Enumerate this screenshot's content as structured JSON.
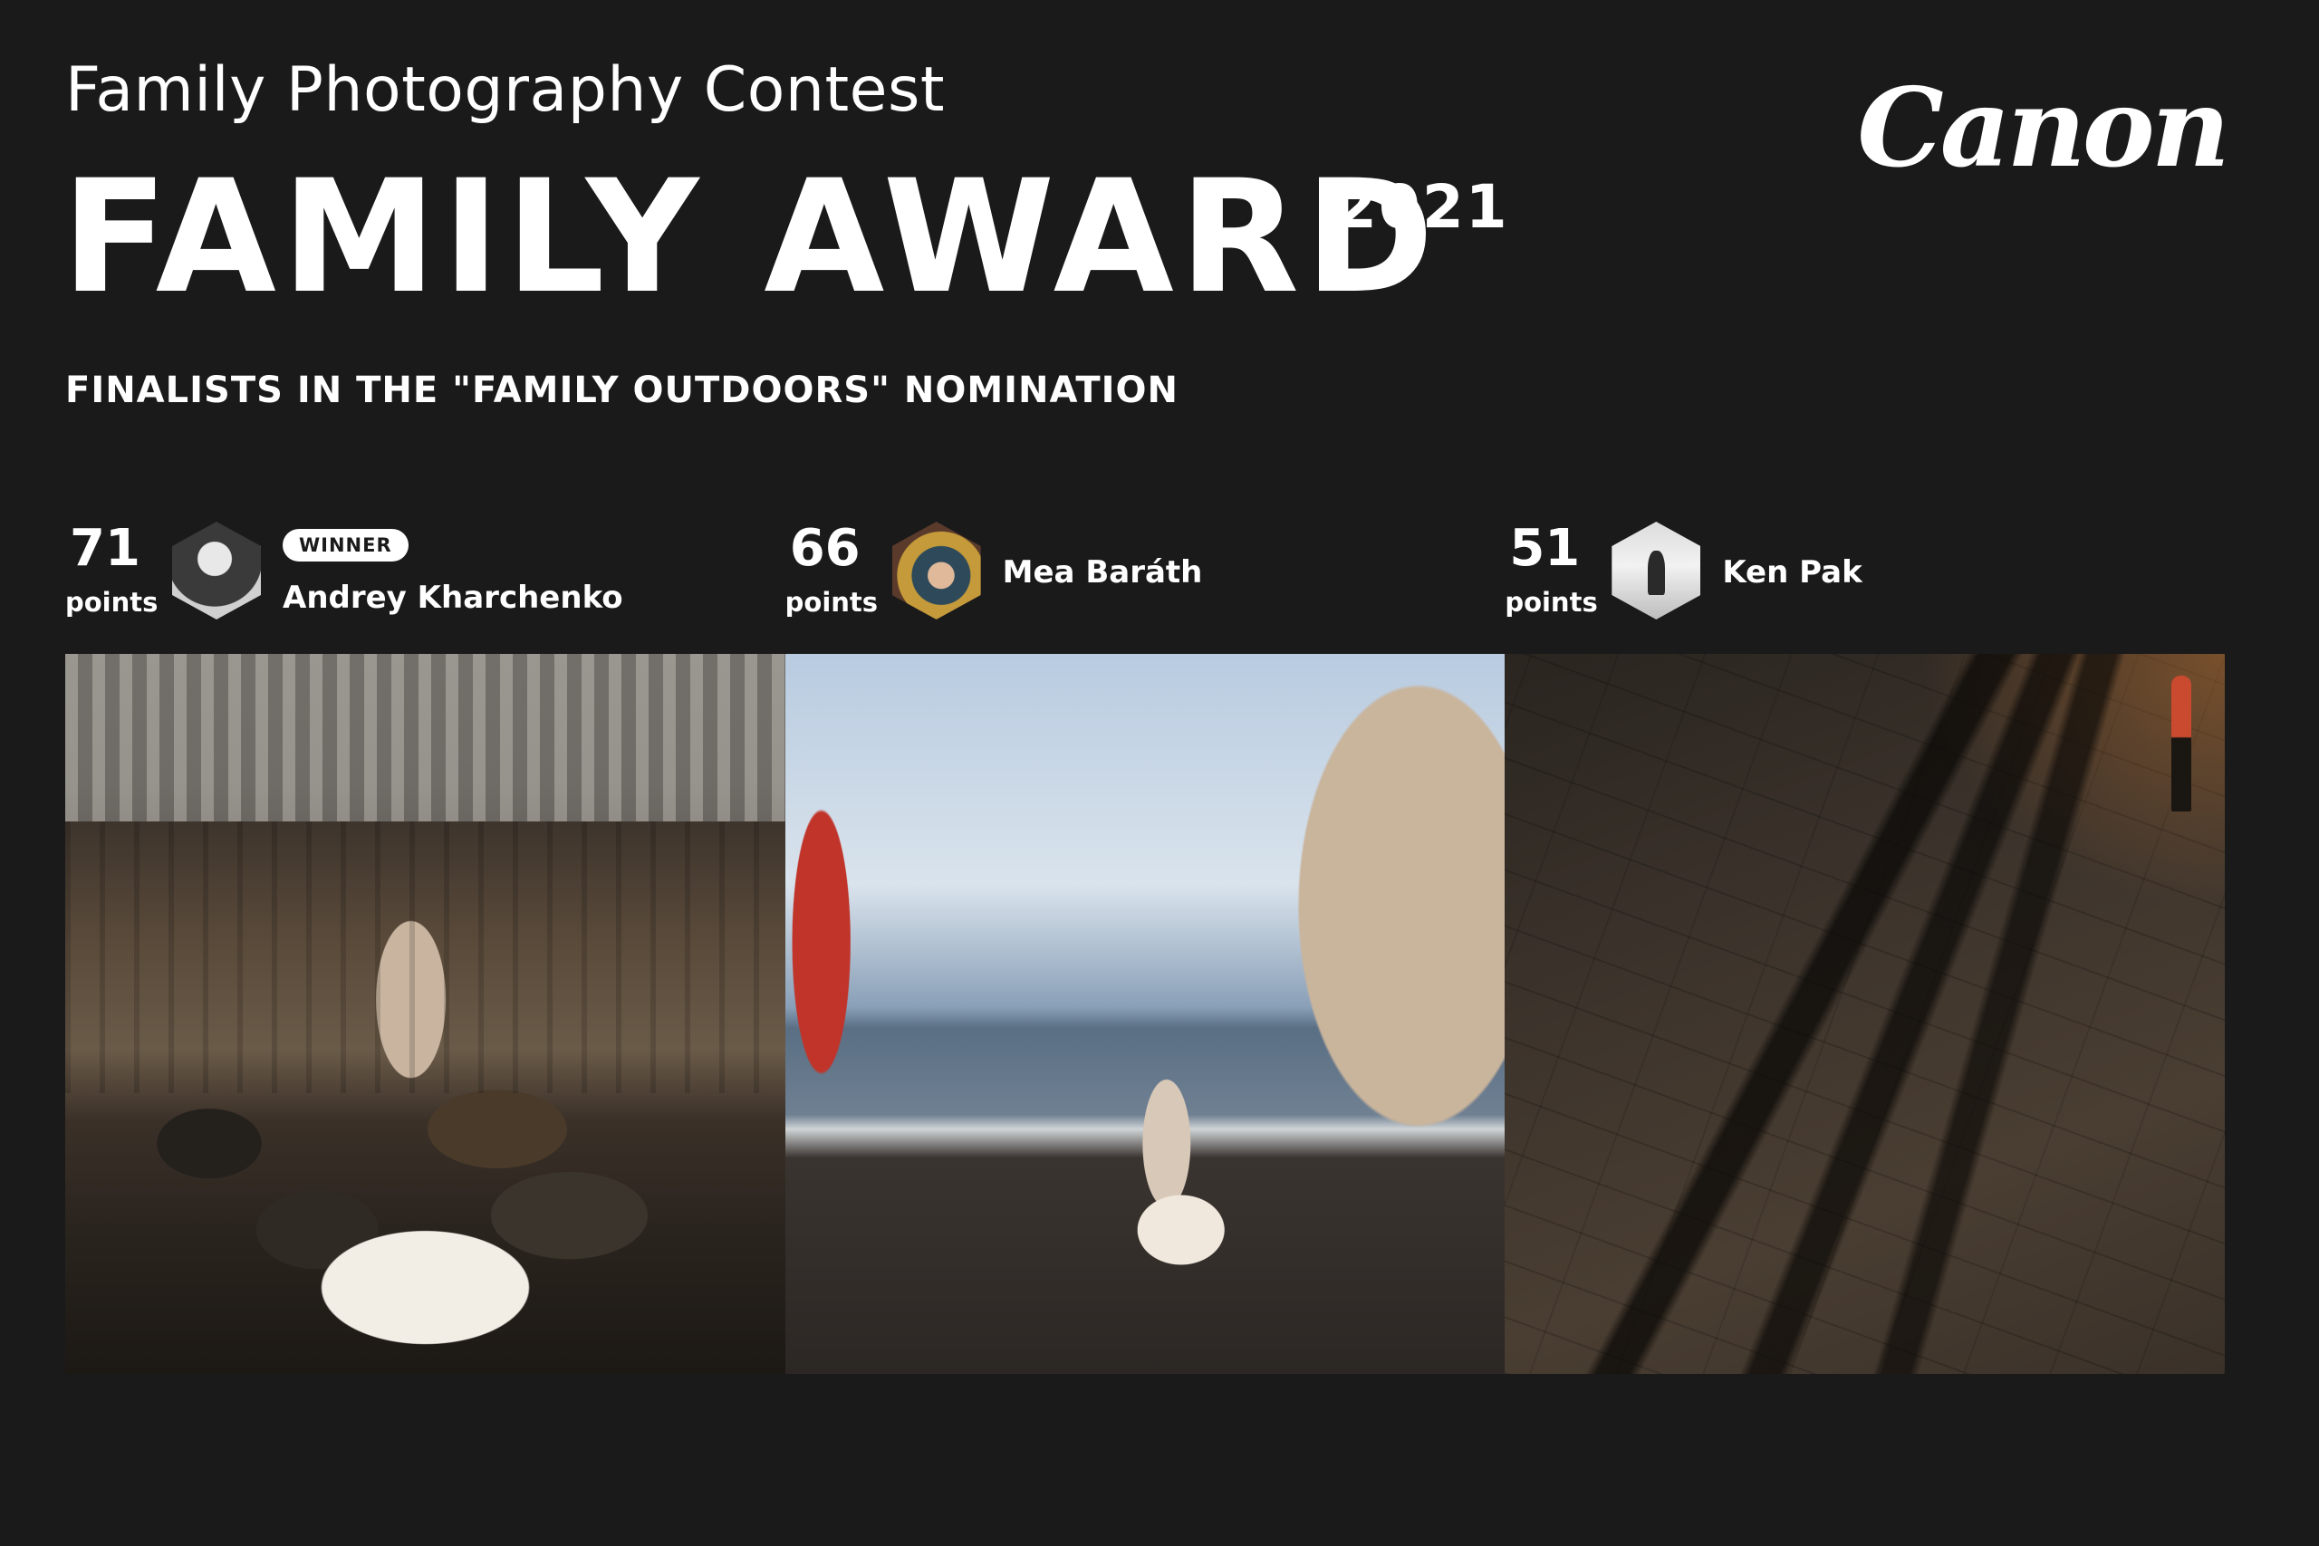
{
  "header": {
    "subtitle": "Family Photography Contest",
    "title": "FAMILY AWARD",
    "year": "2021",
    "nomination": "FINALISTS IN THE \"FAMILY OUTDOORS\" NOMINATION",
    "brand": "Canon"
  },
  "finalists": [
    {
      "points": "71",
      "points_label": "points",
      "badge": "WINNER",
      "name": "Andrey Kharchenko"
    },
    {
      "points": "66",
      "points_label": "points",
      "name": "Mea Baráth"
    },
    {
      "points": "51",
      "points_label": "points",
      "name": "Ken Pak"
    }
  ]
}
